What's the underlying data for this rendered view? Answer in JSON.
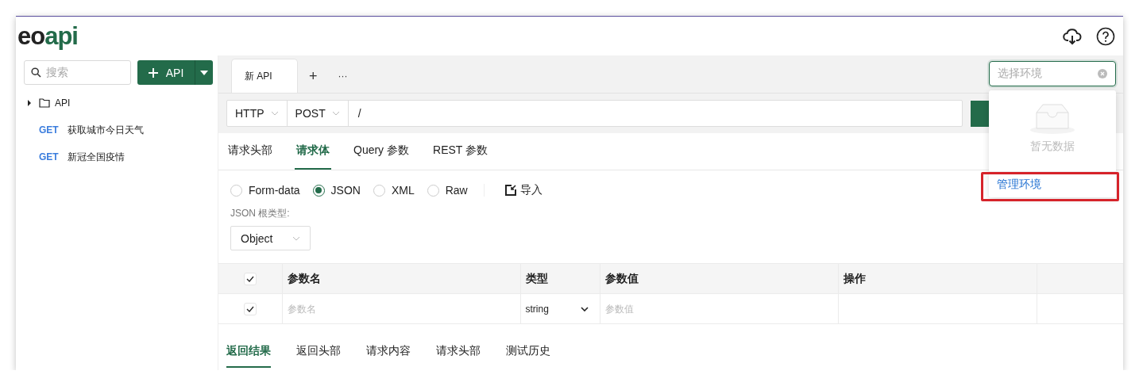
{
  "header": {
    "logo_dark": "eo",
    "logo_accent": "api"
  },
  "sidebar": {
    "search": {
      "placeholder": "搜索"
    },
    "add_button": {
      "label": "API"
    },
    "tree": [
      {
        "kind": "folder",
        "label": "API",
        "expanded": false
      },
      {
        "kind": "api",
        "method": "GET",
        "label": "获取城市今日天气"
      },
      {
        "kind": "api",
        "method": "GET",
        "label": "新冠全国疫情"
      }
    ]
  },
  "tabs": [
    {
      "label": "新 API",
      "selected": true
    }
  ],
  "tab_actions": {
    "add": "+",
    "more": "···"
  },
  "environment": {
    "placeholder": "选择环境",
    "dropdown": {
      "empty_text": "暂无数据",
      "action": "管理环境",
      "highlighted": true
    }
  },
  "request": {
    "protocol": "HTTP",
    "method": "POST",
    "url": "/"
  },
  "section_tabs": [
    {
      "label": "请求头部",
      "selected": false
    },
    {
      "label": "请求体",
      "selected": true
    },
    {
      "label": "Query 参数",
      "selected": false
    },
    {
      "label": "REST 参数",
      "selected": false
    }
  ],
  "body_types": [
    {
      "label": "Form-data",
      "selected": false
    },
    {
      "label": "JSON",
      "selected": true
    },
    {
      "label": "XML",
      "selected": false
    },
    {
      "label": "Raw",
      "selected": false
    }
  ],
  "import_label": "导入",
  "root_type": {
    "label": "JSON 根类型:",
    "value": "Object"
  },
  "table": {
    "header_checked": true,
    "columns": [
      "参数名",
      "类型",
      "参数值",
      "操作"
    ],
    "rows": [
      {
        "checked": true,
        "name_placeholder": "参数名",
        "type": "string",
        "value_placeholder": "参数值"
      }
    ]
  },
  "response_tabs": [
    {
      "label": "返回结果",
      "selected": true
    },
    {
      "label": "返回头部",
      "selected": false
    },
    {
      "label": "请求内容",
      "selected": false
    },
    {
      "label": "请求头部",
      "selected": false
    },
    {
      "label": "测试历史",
      "selected": false
    }
  ]
}
